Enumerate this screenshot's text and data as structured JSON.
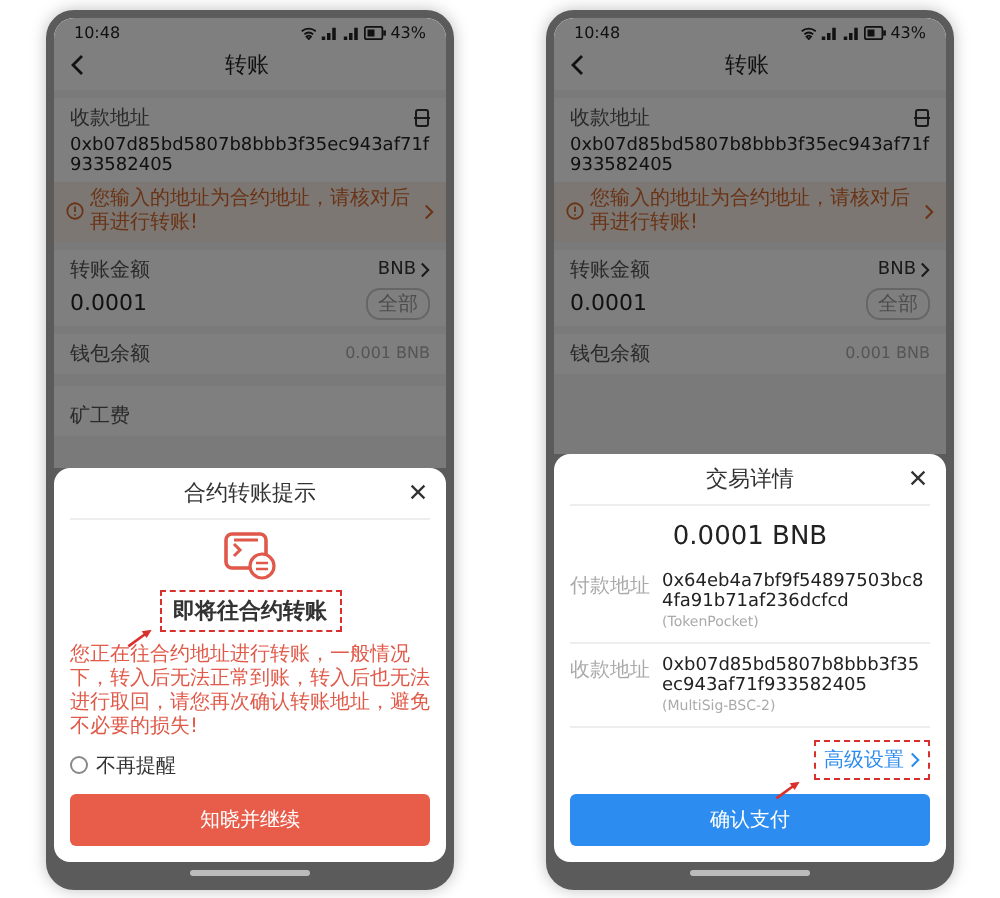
{
  "phones": [
    {
      "status_bar": {
        "time": "10:48",
        "battery": "43%"
      },
      "header": {
        "title": "转账"
      },
      "form": {
        "recipient_label": "收款地址",
        "recipient_address": "0xb07d85bd5807b8bbb3f35ec943af71f933582405",
        "warning": "您输入的地址为合约地址，请核对后再进行转账!",
        "amount_label": "转账金额",
        "token": "BNB",
        "amount": "0.0001",
        "max_button": "全部",
        "balance_label": "钱包余额",
        "balance": "0.001 BNB",
        "fee_label": "矿工费"
      },
      "sheet": {
        "kind": "contract_warning",
        "title": "合约转账提示",
        "heading": "即将往合约转账",
        "message": "您正在往合约地址进行转账，一般情况下，转入后无法正常到账，转入后也无法进行取回，请您再次确认转账地址，避免不必要的损失!",
        "checkbox": {
          "label": "不再提醒",
          "checked": false
        },
        "button": "知晓并继续"
      }
    },
    {
      "status_bar": {
        "time": "10:48",
        "battery": "43%"
      },
      "header": {
        "title": "转账"
      },
      "form": {
        "recipient_label": "收款地址",
        "recipient_address": "0xb07d85bd5807b8bbb3f35ec943af71f933582405",
        "warning": "您输入的地址为合约地址，请核对后再进行转账!",
        "amount_label": "转账金额",
        "token": "BNB",
        "amount": "0.0001",
        "max_button": "全部",
        "balance_label": "钱包余额",
        "balance": "0.001 BNB"
      },
      "sheet": {
        "kind": "transaction_details",
        "title": "交易详情",
        "amount": "0.0001 BNB",
        "rows": [
          {
            "label": "付款地址",
            "address": "0x64eb4a7bf9f54897503bc84fa91b71af236dcfcd",
            "wallet": "(TokenPocket)"
          },
          {
            "label": "收款地址",
            "address": "0xb07d85bd5807b8bbb3f35ec943af71f933582405",
            "wallet": "(MultiSig-BSC-2)"
          }
        ],
        "link": "高级设置",
        "button": "确认支付"
      }
    }
  ]
}
